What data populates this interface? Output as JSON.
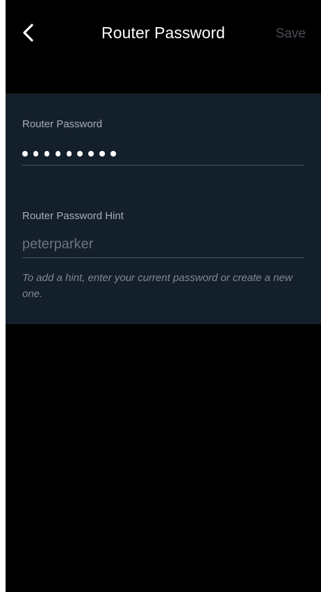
{
  "header": {
    "back_icon": "chevron-left-icon",
    "title": "Router Password",
    "save_label": "Save"
  },
  "password_field": {
    "label": "Router Password",
    "masked_length": 9
  },
  "hint_field": {
    "label": "Router Password Hint",
    "placeholder": "peterparker",
    "value": ""
  },
  "helper_text": "To add a hint, enter your current password or create a new one.",
  "colors": {
    "background": "#000000",
    "card": "#131f2a",
    "label": "#a6aeb7",
    "save_disabled": "#4a4f56"
  }
}
